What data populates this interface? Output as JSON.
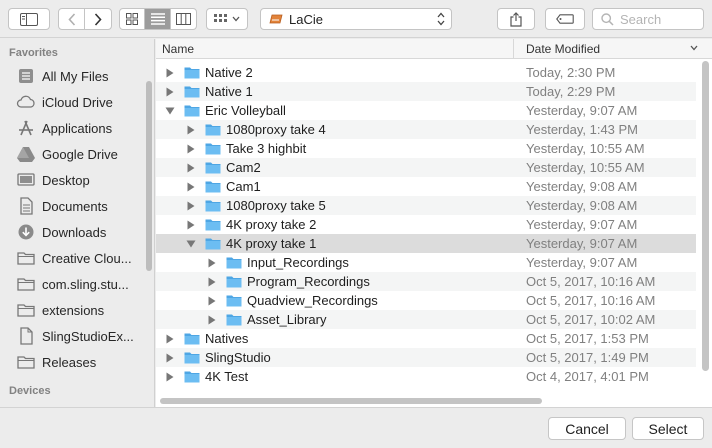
{
  "toolbar": {
    "location": "LaCie",
    "search_placeholder": "Search"
  },
  "sidebar": {
    "favorites_heading": "Favorites",
    "items": [
      {
        "label": "All My Files",
        "icon": "all-files-icon"
      },
      {
        "label": "iCloud Drive",
        "icon": "cloud-icon"
      },
      {
        "label": "Applications",
        "icon": "applications-icon"
      },
      {
        "label": "Google Drive",
        "icon": "google-drive-icon"
      },
      {
        "label": "Desktop",
        "icon": "desktop-icon"
      },
      {
        "label": "Documents",
        "icon": "documents-icon"
      },
      {
        "label": "Downloads",
        "icon": "downloads-icon"
      },
      {
        "label": "Creative Clou...",
        "icon": "folder-icon"
      },
      {
        "label": "com.sling.stu...",
        "icon": "folder-icon"
      },
      {
        "label": "extensions",
        "icon": "folder-icon"
      },
      {
        "label": "SlingStudioEx...",
        "icon": "document-icon"
      },
      {
        "label": "Releases",
        "icon": "folder-icon"
      }
    ],
    "devices_heading": "Devices"
  },
  "columns": {
    "name": "Name",
    "date": "Date Modified"
  },
  "rows": [
    {
      "name": "Native 2",
      "date": "Today, 2:30 PM",
      "level": 0,
      "expanded": false
    },
    {
      "name": "Native 1",
      "date": "Today, 2:29 PM",
      "level": 0,
      "expanded": false
    },
    {
      "name": "Eric Volleyball",
      "date": "Yesterday, 9:07 AM",
      "level": 0,
      "expanded": true
    },
    {
      "name": "1080proxy take 4",
      "date": "Yesterday, 1:43 PM",
      "level": 1,
      "expanded": false
    },
    {
      "name": "Take 3 highbit",
      "date": "Yesterday, 10:55 AM",
      "level": 1,
      "expanded": false
    },
    {
      "name": "Cam2",
      "date": "Yesterday, 10:55 AM",
      "level": 1,
      "expanded": false
    },
    {
      "name": "Cam1",
      "date": "Yesterday, 9:08 AM",
      "level": 1,
      "expanded": false
    },
    {
      "name": "1080proxy take 5",
      "date": "Yesterday, 9:08 AM",
      "level": 1,
      "expanded": false
    },
    {
      "name": "4K proxy take 2",
      "date": "Yesterday, 9:07 AM",
      "level": 1,
      "expanded": false
    },
    {
      "name": "4K proxy take 1",
      "date": "Yesterday, 9:07 AM",
      "level": 1,
      "expanded": true,
      "selected": true
    },
    {
      "name": "Input_Recordings",
      "date": "Yesterday, 9:07 AM",
      "level": 2,
      "expanded": false
    },
    {
      "name": "Program_Recordings",
      "date": "Oct 5, 2017, 10:16 AM",
      "level": 2,
      "expanded": false
    },
    {
      "name": "Quadview_Recordings",
      "date": "Oct 5, 2017, 10:16 AM",
      "level": 2,
      "expanded": false
    },
    {
      "name": "Asset_Library",
      "date": "Oct 5, 2017, 10:02 AM",
      "level": 2,
      "expanded": false
    },
    {
      "name": "Natives",
      "date": "Oct 5, 2017, 1:53 PM",
      "level": 0,
      "expanded": false
    },
    {
      "name": "SlingStudio",
      "date": "Oct 5, 2017, 1:49 PM",
      "level": 0,
      "expanded": false
    },
    {
      "name": "4K Test",
      "date": "Oct 4, 2017, 4:01 PM",
      "level": 0,
      "expanded": false
    }
  ],
  "buttons": {
    "cancel": "Cancel",
    "select": "Select"
  },
  "colors": {
    "folder": "#6cbdf2",
    "folder_dark": "#4ea6e4",
    "selected_row": "#dcdcdc"
  }
}
